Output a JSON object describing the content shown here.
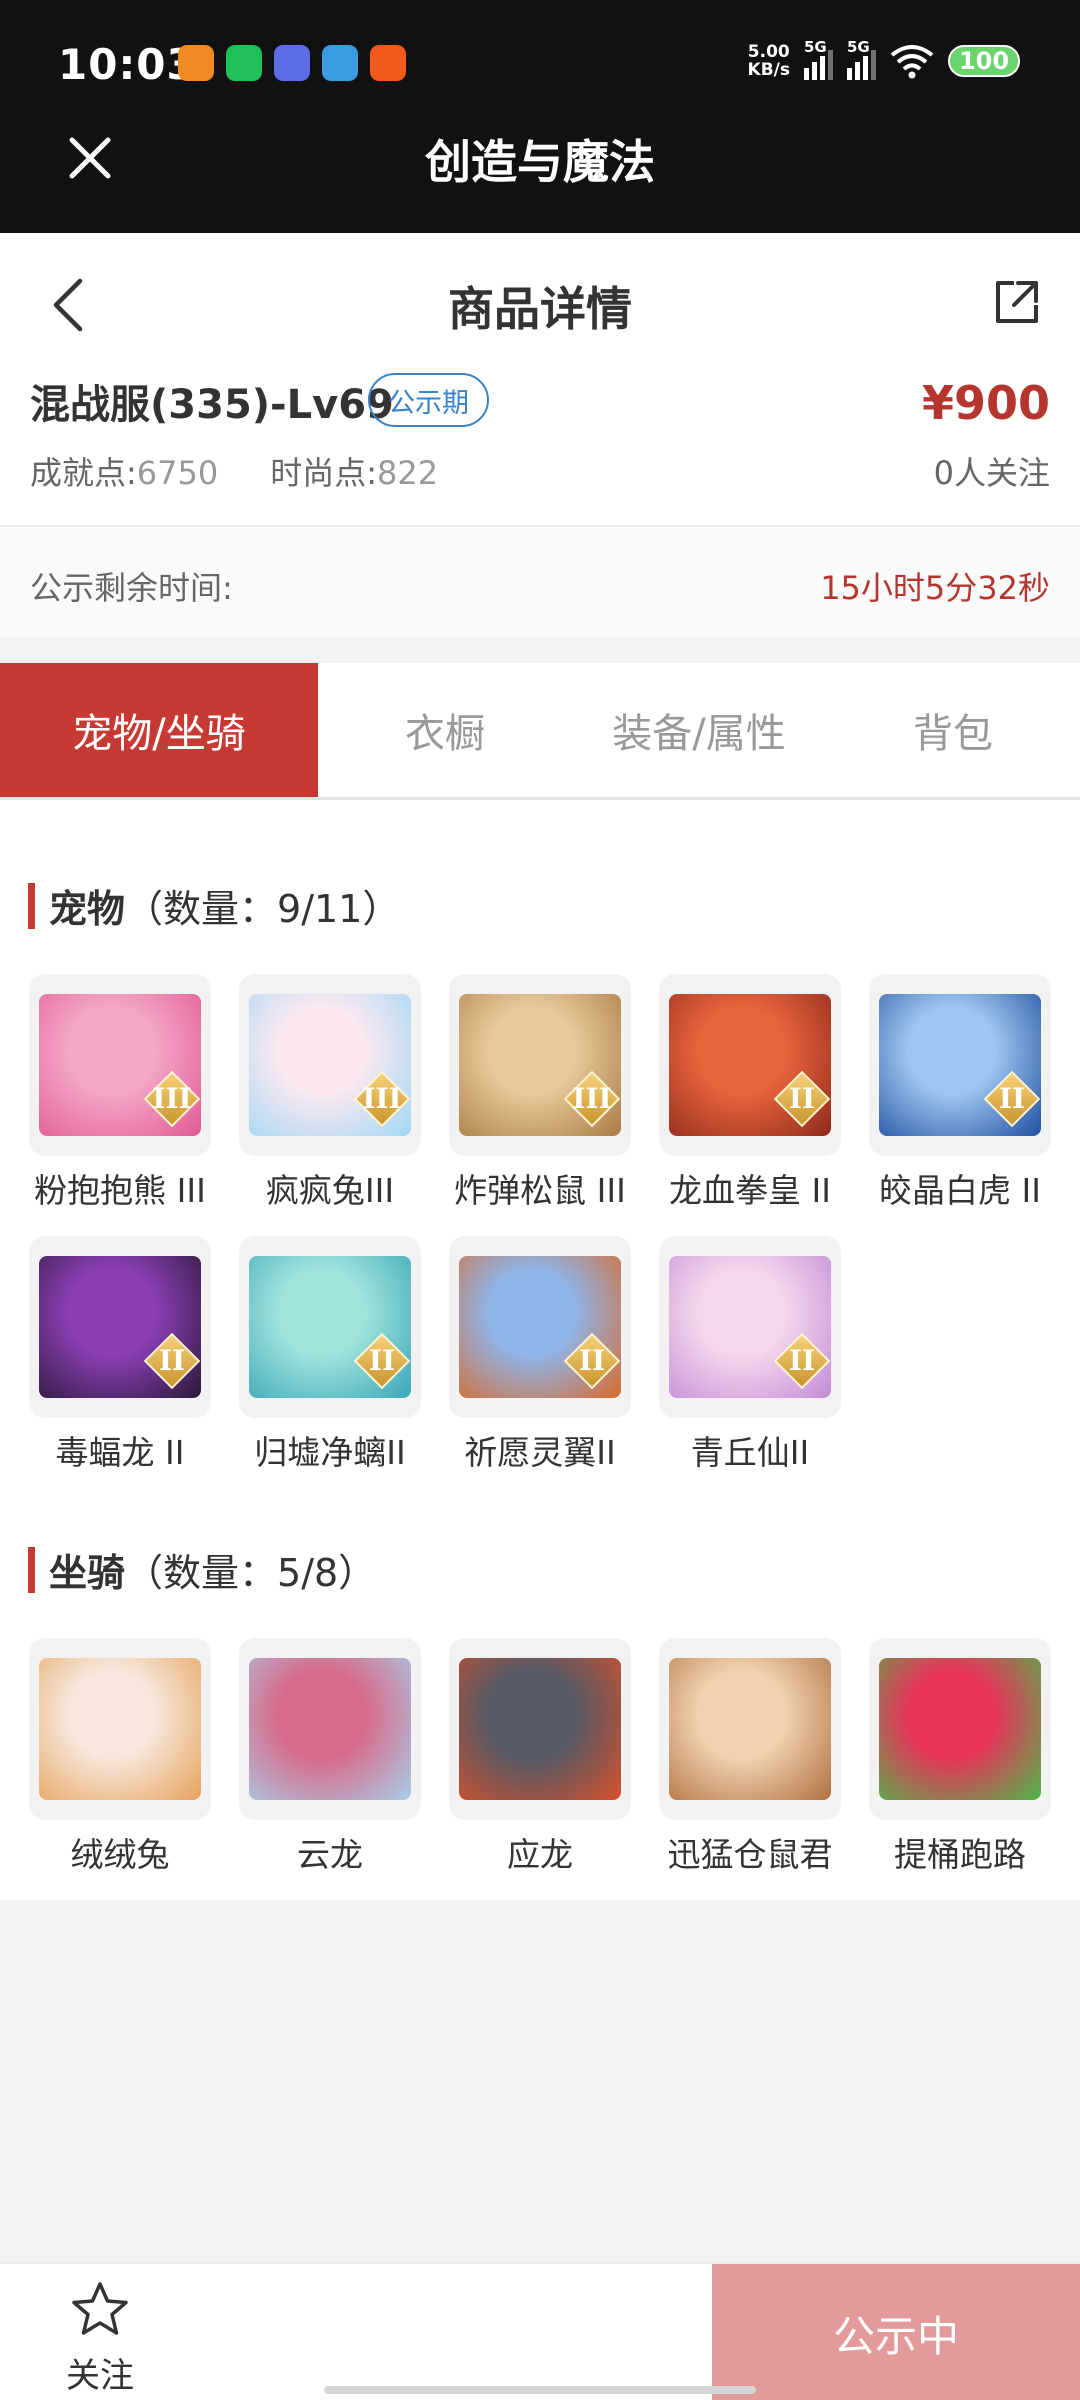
{
  "status_bar": {
    "time": "10:03",
    "net_speed_value": "5.00",
    "net_speed_unit": "KB/s",
    "sim1": "5G",
    "sim2": "5G",
    "battery": "100",
    "app_icons": [
      "video-app-icon",
      "chat-app-icon",
      "weather-app-icon",
      "wallet-app-icon",
      "shopping-app-icon"
    ]
  },
  "app_bar": {
    "title": "创造与魔法"
  },
  "header": {
    "title": "商品详情"
  },
  "product": {
    "server": "混战服(335)-Lv69",
    "badge": "公示期",
    "achievement_label": "成就点:",
    "achievement_value": "6750",
    "fashion_label": "时尚点:",
    "fashion_value": "822",
    "price": "¥900",
    "followers": "0人关注"
  },
  "timer": {
    "label": "公示剩余时间:",
    "value": "15小时5分32秒"
  },
  "tabs": [
    {
      "label": "宠物/坐骑",
      "active": true
    },
    {
      "label": "衣橱",
      "active": false
    },
    {
      "label": "装备/属性",
      "active": false
    },
    {
      "label": "背包",
      "active": false
    }
  ],
  "pets": {
    "title": "宠物",
    "count": "（数量：9/11）",
    "items": [
      {
        "name": "粉抱抱熊 III",
        "tier": "III",
        "colors": [
          "#f4a6c6",
          "#e05a95"
        ]
      },
      {
        "name": "疯疯兔III",
        "tier": "III",
        "colors": [
          "#fbe8f1",
          "#9fd8f4"
        ]
      },
      {
        "name": "炸弹松鼠 III",
        "tier": "III",
        "colors": [
          "#e8c99a",
          "#a87b45"
        ]
      },
      {
        "name": "龙血拳皇 II",
        "tier": "II",
        "colors": [
          "#e8643c",
          "#8e2a1c"
        ]
      },
      {
        "name": "皎晶白虎 II",
        "tier": "II",
        "colors": [
          "#9ec6f0",
          "#1f4fa0"
        ]
      },
      {
        "name": "毒蝠龙 II",
        "tier": "II",
        "colors": [
          "#8b3fb5",
          "#2a1838"
        ]
      },
      {
        "name": "归墟净螭II",
        "tier": "II",
        "colors": [
          "#9fe3dc",
          "#3aa6b8"
        ]
      },
      {
        "name": "祈愿灵翼II",
        "tier": "II",
        "colors": [
          "#8fb4e8",
          "#d86a2a"
        ]
      },
      {
        "name": "青丘仙II",
        "tier": "II",
        "colors": [
          "#f4d7ec",
          "#c48ad8"
        ]
      }
    ]
  },
  "mounts": {
    "title": "坐骑",
    "count": "（数量：5/8）",
    "items": [
      {
        "name": "绒绒兔",
        "colors": [
          "#f7e7dc",
          "#e6a25a"
        ]
      },
      {
        "name": "云龙",
        "colors": [
          "#d86a8a",
          "#a7cfe8"
        ]
      },
      {
        "name": "应龙",
        "colors": [
          "#555a66",
          "#d8502a"
        ]
      },
      {
        "name": "迅猛仓鼠君",
        "colors": [
          "#f1d2b0",
          "#b07040"
        ]
      },
      {
        "name": "提桶跑路",
        "colors": [
          "#e8345a",
          "#4cb84a"
        ]
      }
    ]
  },
  "bottom_bar": {
    "follow_label": "关注",
    "status_button": "公示中"
  },
  "colors": {
    "accent": "#c73a33",
    "price": "#b5362f",
    "badge": "#3b83c9",
    "status_button": "#e39a9a"
  }
}
